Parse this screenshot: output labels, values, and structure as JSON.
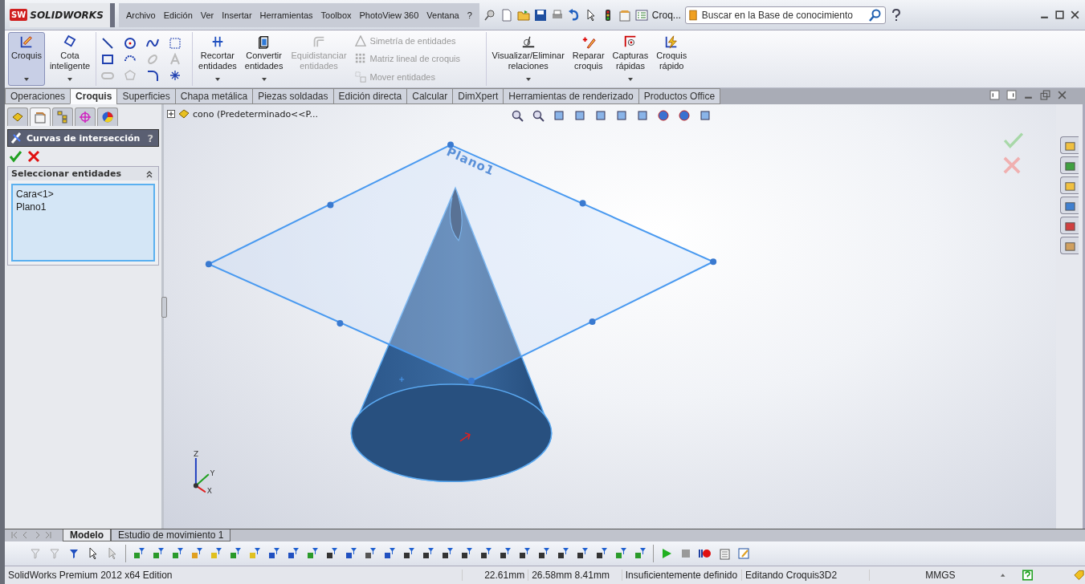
{
  "title_bar": {
    "logo_badge": "SW",
    "logo": "SOLIDWORKS",
    "menu": [
      "Archivo",
      "Edición",
      "Ver",
      "Insertar",
      "Herramientas",
      "Toolbox",
      "PhotoView 360",
      "Ventana",
      "?"
    ],
    "document_label": "Croq...",
    "search": {
      "placeholder": "Buscar en la Base de conocimiento"
    }
  },
  "ribbon": {
    "large_buttons": [
      {
        "label": "Croquis",
        "selected": true,
        "disabled": false,
        "kind": "sketch",
        "dropdown": true
      },
      {
        "label": "Cota inteligente",
        "selected": false,
        "disabled": false,
        "kind": "dimension",
        "dropdown": true
      },
      {
        "label": "Recortar entidades",
        "selected": false,
        "disabled": false,
        "kind": "trim",
        "dropdown": true
      },
      {
        "label": "Convertir entidades",
        "selected": false,
        "disabled": false,
        "kind": "convert",
        "dropdown": true
      },
      {
        "label": "Equidistanciar entidades",
        "selected": false,
        "disabled": true,
        "kind": "offset",
        "dropdown": false
      }
    ],
    "small_buttons": [
      {
        "label": "Simetría de entidades",
        "disabled": true,
        "kind": "mirror"
      },
      {
        "label": "Matriz lineal de croquis",
        "disabled": true,
        "kind": "pattern"
      },
      {
        "label": "Mover entidades",
        "disabled": true,
        "kind": "move"
      }
    ],
    "right_buttons": [
      {
        "label": "Visualizar/Eliminar relaciones",
        "selected": false,
        "disabled": false,
        "kind": "relations",
        "dropdown": true
      },
      {
        "label": "Reparar croquis",
        "selected": false,
        "disabled": false,
        "kind": "repair",
        "dropdown": false
      },
      {
        "label": "Capturas rápidas",
        "selected": false,
        "disabled": false,
        "kind": "snaps",
        "dropdown": true
      },
      {
        "label": "Croquis rápido",
        "selected": false,
        "disabled": false,
        "kind": "rapid",
        "dropdown": false
      }
    ]
  },
  "tabs": [
    {
      "label": "Operaciones",
      "selected": false
    },
    {
      "label": "Croquis",
      "selected": true
    },
    {
      "label": "Superficies",
      "selected": false
    },
    {
      "label": "Chapa metálica",
      "selected": false
    },
    {
      "label": "Piezas soldadas",
      "selected": false
    },
    {
      "label": "Edición directa",
      "selected": false
    },
    {
      "label": "Calcular",
      "selected": false
    },
    {
      "label": "DimXpert",
      "selected": false
    },
    {
      "label": "Herramientas de renderizado",
      "selected": false
    },
    {
      "label": "Productos Office",
      "selected": false
    }
  ],
  "panel_tabs": [
    {
      "selected": false
    },
    {
      "selected": true
    },
    {
      "selected": false
    },
    {
      "selected": false
    },
    {
      "selected": false
    }
  ],
  "property_manager": {
    "title": "Curvas de intersección",
    "help": "?",
    "section": {
      "title": "Seleccionar entidades",
      "expanded": true,
      "items": [
        "Cara<1>",
        "Plano1"
      ]
    }
  },
  "viewport": {
    "tree_item": "cono  (Predeterminado<<P...",
    "plane_label": "Plano1",
    "axes": [
      "Z",
      "Y",
      "X"
    ]
  },
  "bottom_tabs": [
    {
      "label": "Modelo",
      "selected": true
    },
    {
      "label": "Estudio de movimiento 1",
      "selected": false
    }
  ],
  "status_bar": {
    "product": "SolidWorks Premium 2012 x64 Edition",
    "x": "22.61mm",
    "yz": "26.58mm  8.41mm",
    "definition": "Insuficientemente definido",
    "mode": "Editando Croquis3D2",
    "units": "MMGS"
  }
}
